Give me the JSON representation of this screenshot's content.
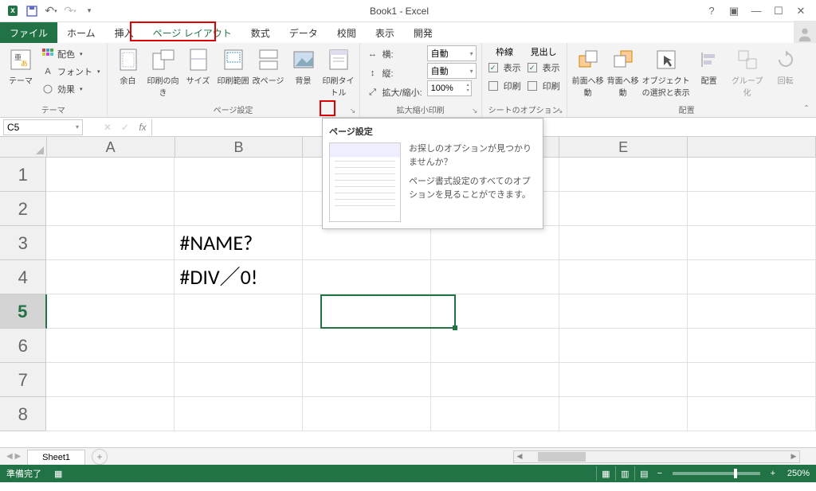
{
  "titlebar": {
    "title": "Book1 - Excel"
  },
  "tabs": {
    "file": "ファイル",
    "home": "ホーム",
    "insert": "挿入",
    "pagelayout": "ページ レイアウト",
    "formulas": "数式",
    "data": "データ",
    "review": "校閲",
    "view": "表示",
    "developer": "開発"
  },
  "ribbon": {
    "themes": {
      "group": "テーマ",
      "theme": "テーマ",
      "colors": "配色",
      "fonts": "フォント",
      "effects": "効果"
    },
    "pagesetup": {
      "group": "ページ設定",
      "margins": "余白",
      "orientation": "印刷の向き",
      "size": "サイズ",
      "printarea": "印刷範囲",
      "breaks": "改ページ",
      "background": "背景",
      "printtitles": "印刷タイトル"
    },
    "scale": {
      "group": "拡大縮小印刷",
      "width": "横:",
      "height": "縦:",
      "scale": "拡大/縮小:",
      "auto": "自動",
      "scale_val": "100%"
    },
    "sheetopts": {
      "group": "シートのオプション",
      "gridlines": "枠線",
      "headings": "見出し",
      "view": "表示",
      "print": "印刷"
    },
    "arrange": {
      "group": "配置",
      "forward": "前面へ移動",
      "backward": "背面へ移動",
      "selection": "オブジェクトの選択と表示",
      "align": "配置",
      "groupobj": "グループ化",
      "rotate": "回転"
    }
  },
  "tooltip": {
    "title": "ページ設定",
    "line1": "お探しのオプションが見つかりませんか？",
    "line2": "ページ書式設定のすべてのオプションを見ることができます。"
  },
  "fbar": {
    "cellref": "C5"
  },
  "grid": {
    "cols": [
      "A",
      "B",
      "",
      "",
      "E",
      ""
    ],
    "rows": [
      "1",
      "2",
      "3",
      "4",
      "5",
      "6",
      "7",
      "8"
    ],
    "cells": {
      "B3": "#NAME?",
      "B4": "#DIV／0!"
    },
    "active": "C5"
  },
  "sheet": {
    "tab": "Sheet1"
  },
  "status": {
    "ready": "準備完了",
    "zoom": "250%"
  }
}
